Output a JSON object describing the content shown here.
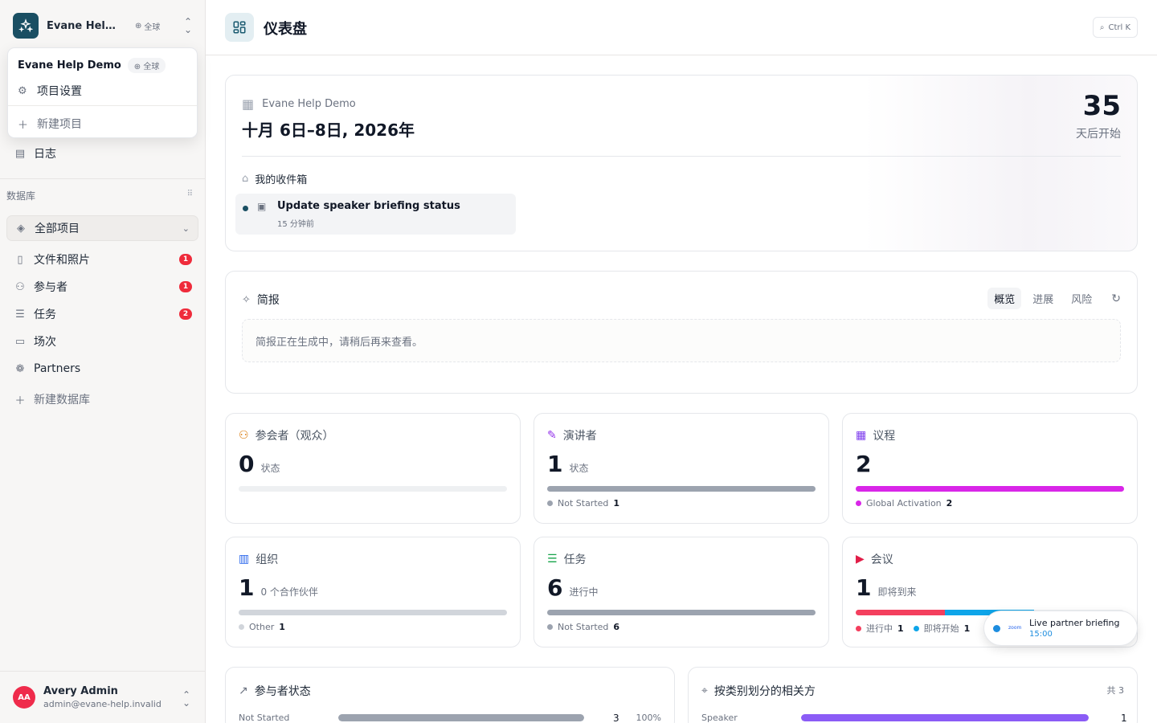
{
  "workspace": {
    "name": "Evane Help Demo",
    "scope": "全球"
  },
  "dropdown": {
    "title": "Evane Help Demo",
    "scope": "全球",
    "settings_label": "项目设置",
    "new_project_label": "新建项目"
  },
  "sidebar": {
    "log_label": "日志",
    "section_label": "数据库",
    "all_projects_label": "全部项目",
    "items": [
      {
        "label": "文件和照片",
        "badge": "1",
        "icon": "file-icon"
      },
      {
        "label": "参与者",
        "badge": "1",
        "icon": "users-icon"
      },
      {
        "label": "任务",
        "badge": "2",
        "icon": "checklist-icon"
      },
      {
        "label": "场次",
        "badge": "",
        "icon": "presentation-icon"
      },
      {
        "label": "Partners",
        "badge": "",
        "icon": "partners-icon"
      }
    ],
    "new_db_label": "新建数据库"
  },
  "user": {
    "initials": "AA",
    "name": "Avery Admin",
    "email": "admin@evane-help.invalid"
  },
  "header": {
    "title": "仪表盘",
    "shortcut": "Ctrl K"
  },
  "event": {
    "org": "Evane Help Demo",
    "date": "十月 6日–8日, 2026年",
    "countdown": "35",
    "countdown_label": "天后开始",
    "inbox_title": "我的收件箱",
    "inbox_item": "Update speaker briefing status",
    "inbox_time": "15 分钟前"
  },
  "briefing": {
    "title": "简报",
    "tabs": [
      "概览",
      "进展",
      "风险"
    ],
    "active_tab": 0,
    "body": "简报正在生成中，请稍后再来查看。"
  },
  "stats": [
    {
      "title": "参会者（观众）",
      "icon": "attendees-icon",
      "icon_color": "#d97706",
      "value": "0",
      "label": "状态",
      "segments": [],
      "legend": []
    },
    {
      "title": "演讲者",
      "icon": "mic-icon",
      "icon_color": "#9333ea",
      "value": "1",
      "label": "状态",
      "segments": [
        {
          "color": "#9ca3af",
          "fraction": 1
        }
      ],
      "legend": [
        {
          "color": "#9ca3af",
          "name": "Not Started",
          "count": "1"
        }
      ]
    },
    {
      "title": "议程",
      "icon": "calendar-icon",
      "icon_color": "#7c3aed",
      "value": "2",
      "label": "",
      "segments": [
        {
          "color": "#d926e8",
          "fraction": 1
        }
      ],
      "legend": [
        {
          "color": "#d926e8",
          "name": "Global Activation",
          "count": "2"
        }
      ]
    },
    {
      "title": "组织",
      "icon": "building-icon",
      "icon_color": "#2563eb",
      "value": "1",
      "label": "0 个合作伙伴",
      "segments": [
        {
          "color": "#d1d5db",
          "fraction": 1
        }
      ],
      "legend": [
        {
          "color": "#d1d5db",
          "name": "Other",
          "count": "1"
        }
      ]
    },
    {
      "title": "任务",
      "icon": "task-icon",
      "icon_color": "#16a34a",
      "value": "6",
      "label": "进行中",
      "segments": [
        {
          "color": "#9ca3af",
          "fraction": 1
        }
      ],
      "legend": [
        {
          "color": "#9ca3af",
          "name": "Not Started",
          "count": "6"
        }
      ]
    },
    {
      "title": "会议",
      "icon": "video-icon",
      "icon_color": "#e11d48",
      "value": "1",
      "label": "即将到来",
      "segments": [
        {
          "color": "#f43f5e",
          "fraction": 0.333
        },
        {
          "color": "#0ea5e9",
          "fraction": 0.333
        }
      ],
      "legend": [
        {
          "color": "#f43f5e",
          "name": "进行中",
          "count": "1"
        },
        {
          "color": "#0ea5e9",
          "name": "即将开始",
          "count": "1"
        }
      ]
    }
  ],
  "live": {
    "app": "zoom",
    "title": "Live partner briefing",
    "time": "15:00"
  },
  "participant_status": {
    "title": "参与者状态",
    "rows": [
      {
        "name": "Not Started",
        "value": "3",
        "fraction": 1,
        "pct": "100%",
        "color": "#9ca3af"
      }
    ]
  },
  "stakeholders": {
    "title": "按类别划分的相关方",
    "total": "共 3",
    "rows": [
      {
        "name": "Speaker",
        "value": "1",
        "fraction": 1,
        "color": "#8b5cf6"
      }
    ]
  }
}
